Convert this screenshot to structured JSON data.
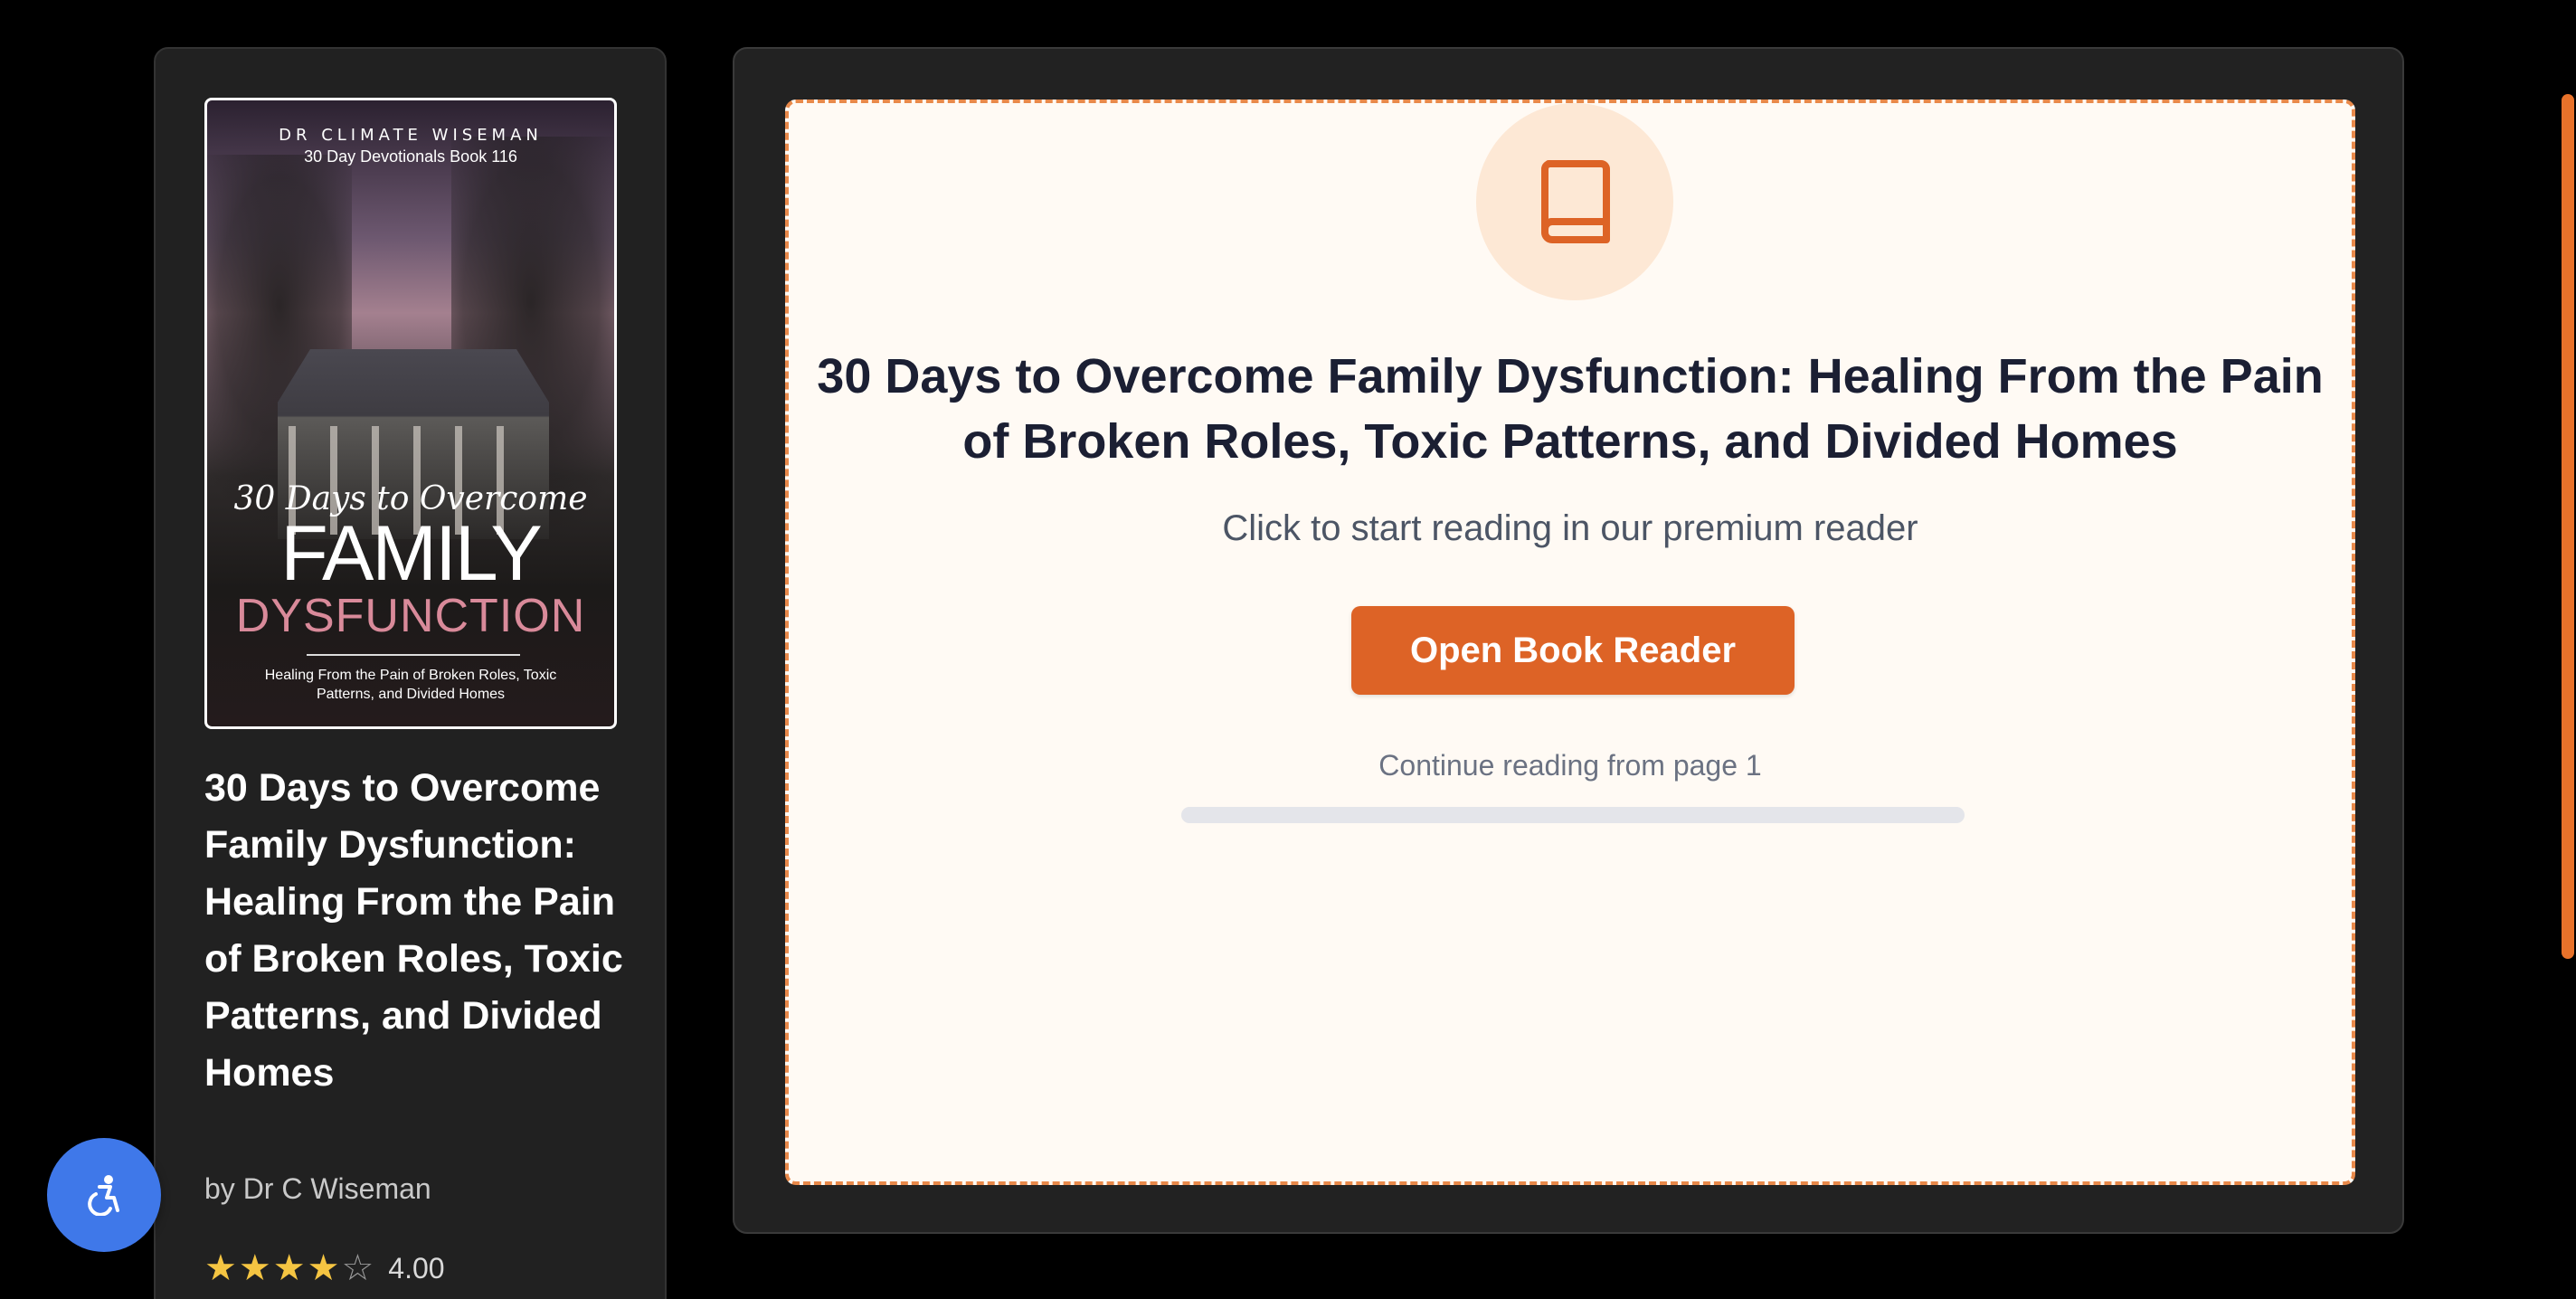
{
  "book": {
    "cover": {
      "author_line": "DR CLIMATE WISEMAN",
      "series_line": "30 Day Devotionals Book 116",
      "title_line1": "30 Days to Overcome",
      "title_line2": "FAMILY",
      "title_line3": "DYSFUNCTION",
      "subtitle": "Healing From the Pain of Broken Roles, Toxic Patterns, and Divided Homes"
    },
    "title": "30 Days to Overcome Family Dysfunction: Healing From the Pain of Broken Roles, Toxic Patterns, and Divided Homes",
    "author": "by Dr C Wiseman",
    "rating": {
      "value": "4.00",
      "stars_filled": 4,
      "stars_total": 5
    }
  },
  "reader": {
    "icon": "book-icon",
    "title": "30 Days to Overcome Family Dysfunction: Healing From the Pain of Broken Roles, Toxic Patterns, and Divided Homes",
    "subtitle": "Click to start reading in our premium reader",
    "button_label": "Open Book Reader",
    "continue_text": "Continue reading from page 1",
    "progress_percent": 0
  },
  "accessibility": {
    "icon": "accessibility-icon"
  },
  "colors": {
    "accent": "#dd6326",
    "page_bg": "#000000",
    "panel_bg": "#222222",
    "reader_bg": "#fffaf4",
    "fab": "#3f78e9",
    "star": "#f5c542"
  }
}
